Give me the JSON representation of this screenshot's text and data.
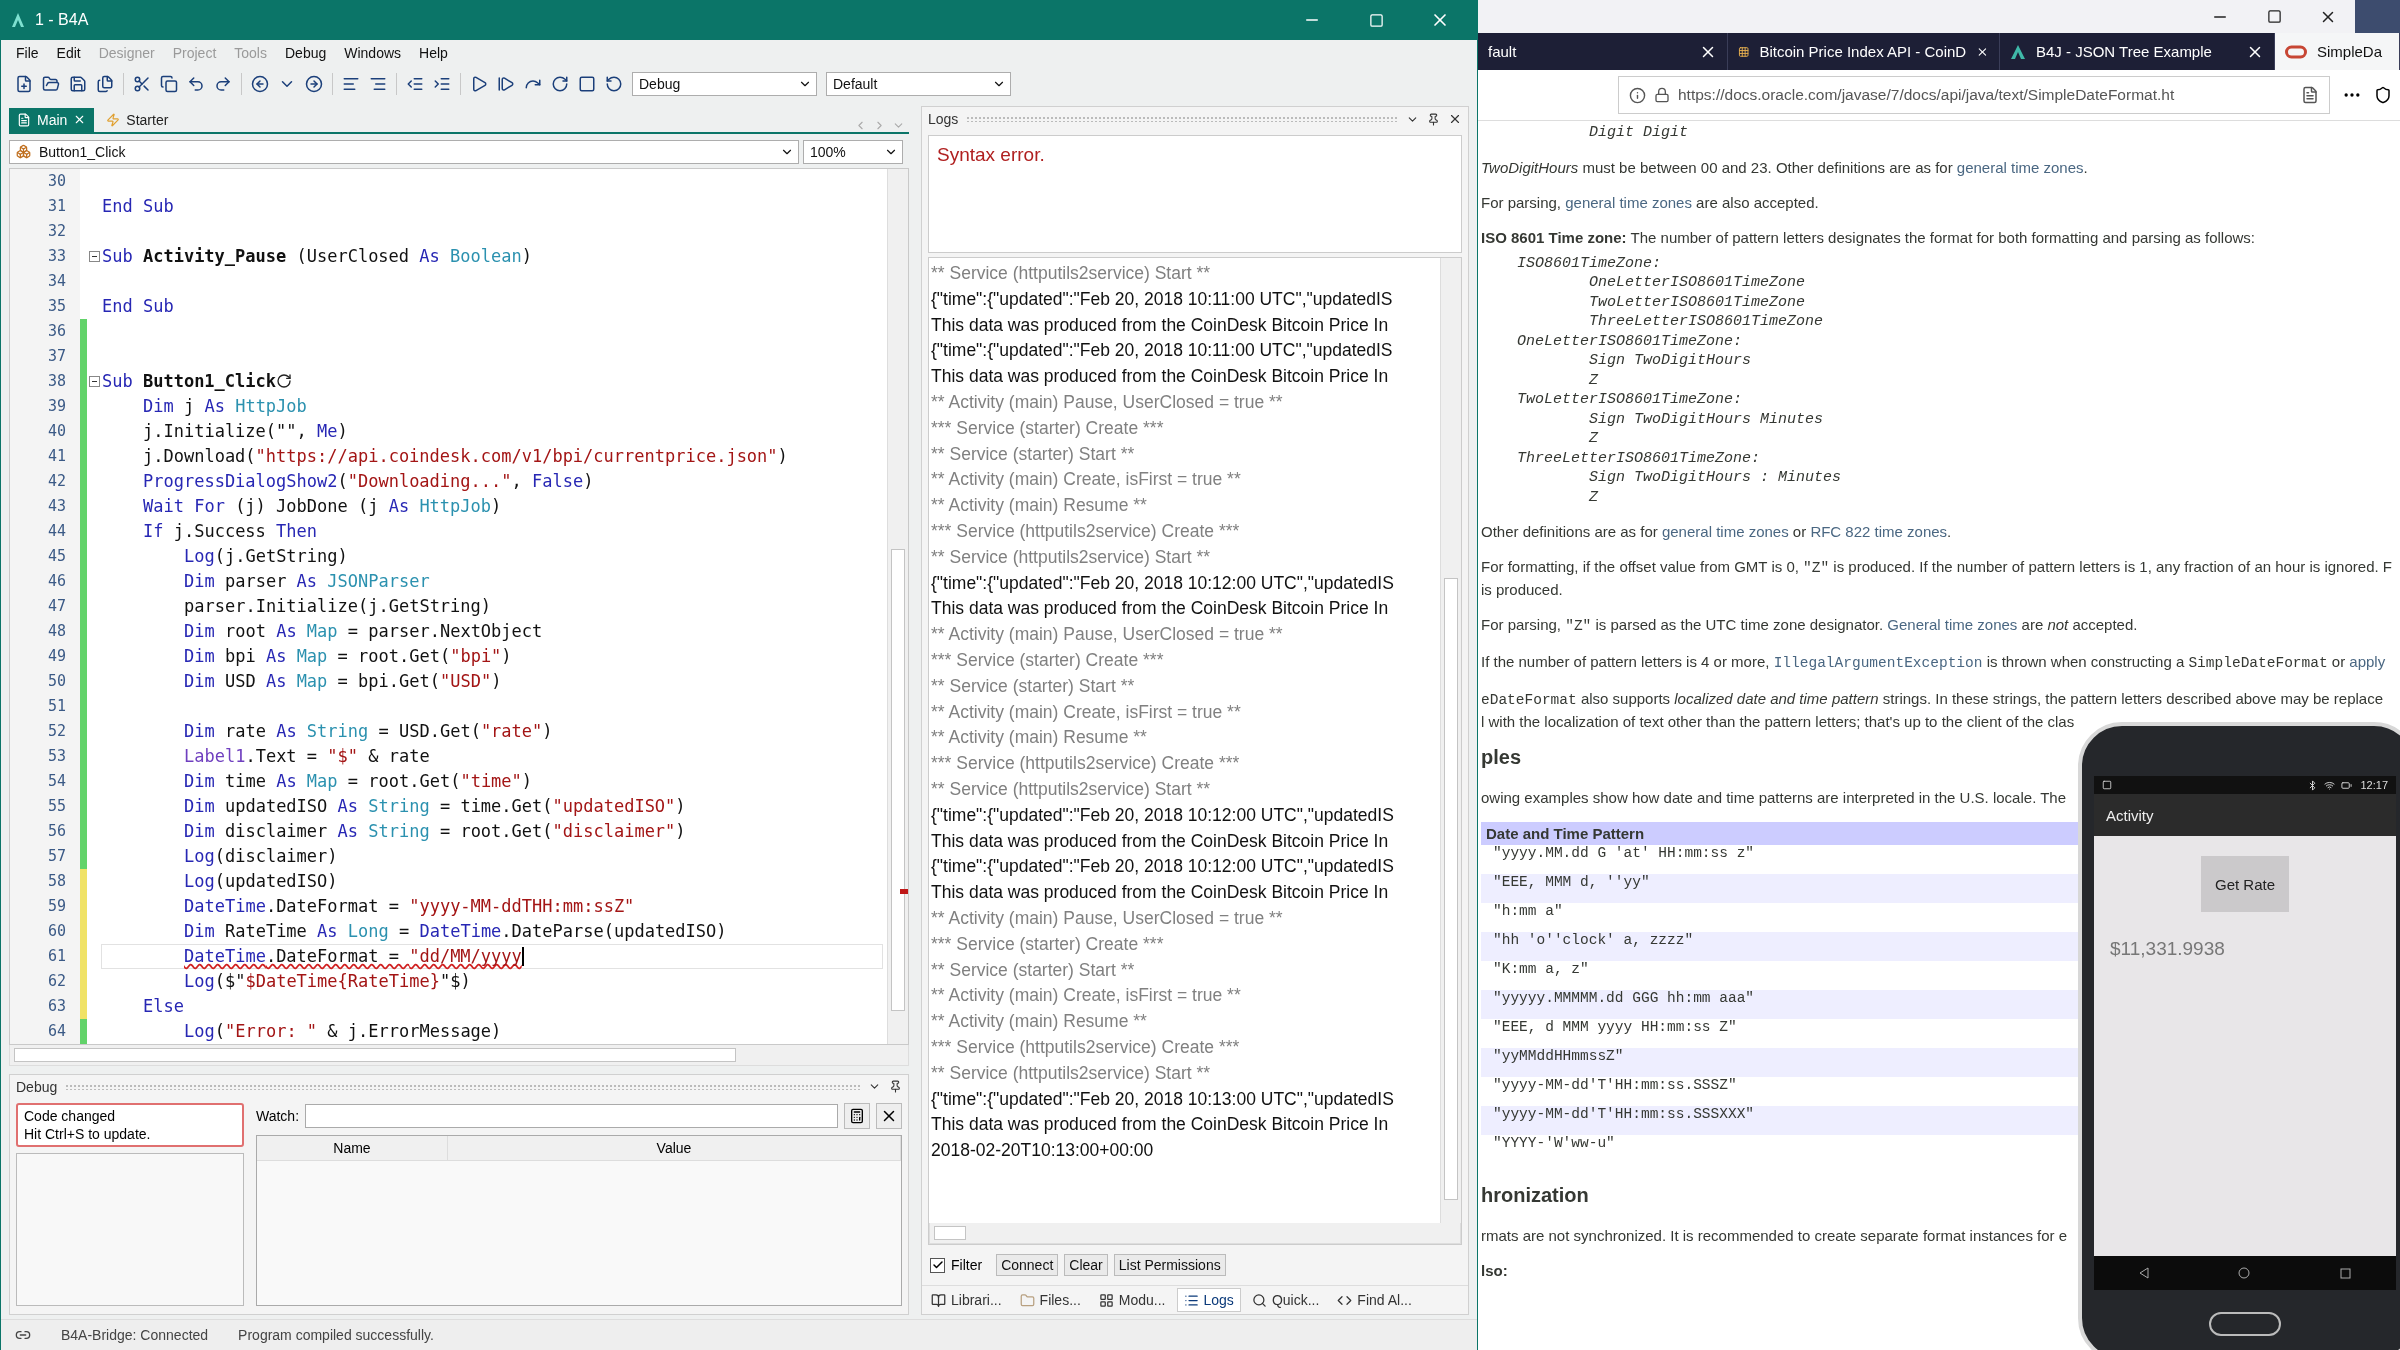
{
  "ide": {
    "title": "1 - B4A",
    "menu": [
      {
        "label": "File",
        "disabled": false
      },
      {
        "label": "Edit",
        "disabled": false
      },
      {
        "label": "Designer",
        "disabled": true
      },
      {
        "label": "Project",
        "disabled": true
      },
      {
        "label": "Tools",
        "disabled": true
      },
      {
        "label": "Debug",
        "disabled": false
      },
      {
        "label": "Windows",
        "disabled": false
      },
      {
        "label": "Help",
        "disabled": false
      }
    ],
    "toolbar": {
      "build_config": "Debug",
      "variant": "Default"
    },
    "editor": {
      "tabs": [
        {
          "label": "Main",
          "selected": true
        },
        {
          "label": "Starter",
          "selected": false
        }
      ],
      "member": "Button1_Click",
      "zoom": "100%",
      "lines": [
        {
          "no": "30"
        },
        {
          "no": "31",
          "tokens": [
            {
              "kind": "kw",
              "text": "End Sub"
            }
          ]
        },
        {
          "no": "32"
        },
        {
          "no": "33",
          "tokens": [
            {
              "kind": "fold"
            },
            {
              "kind": "kw",
              "text": "Sub "
            },
            {
              "kind": "name",
              "text": "Activity_Pause"
            },
            {
              "kind": "plain",
              "text": " (UserClosed "
            },
            {
              "kind": "kw",
              "text": "As "
            },
            {
              "kind": "type",
              "text": "Boolean"
            },
            {
              "kind": "plain",
              "text": ")"
            }
          ]
        },
        {
          "no": "34"
        },
        {
          "no": "35",
          "tokens": [
            {
              "kind": "kw",
              "text": "End Sub"
            }
          ]
        },
        {
          "no": "36",
          "color": "#62d36a"
        },
        {
          "no": "37",
          "color": "#62d36a"
        },
        {
          "no": "38",
          "color": "#62d36a",
          "tokens": [
            {
              "kind": "fold"
            },
            {
              "kind": "kw",
              "text": "Sub "
            },
            {
              "kind": "name",
              "text": "Button1_Click"
            },
            {
              "kind": "restart_mark"
            }
          ],
          "children": [
            {
              "no": "39",
              "color": "#62d36a",
              "tokens": [
                {
                  "kind": "kw",
                  "text": "Dim "
                },
                {
                  "kind": "plain",
                  "text": "j "
                },
                {
                  "kind": "kw",
                  "text": "As "
                },
                {
                  "kind": "type",
                  "text": "HttpJob"
                }
              ]
            },
            {
              "no": "40",
              "color": "#62d36a",
              "tokens": [
                {
                  "kind": "plain",
                  "text": "j.Initialize(\"\", "
                },
                {
                  "kind": "kw",
                  "text": "Me"
                },
                {
                  "kind": "plain",
                  "text": ")"
                }
              ]
            },
            {
              "no": "41",
              "color": "#62d36a",
              "tokens": [
                {
                  "kind": "plain",
                  "text": "j.Download("
                },
                {
                  "kind": "str",
                  "text": "\"https://api.coindesk.com/v1/bpi/currentprice.json\""
                },
                {
                  "kind": "plain",
                  "text": ")"
                }
              ]
            },
            {
              "no": "42",
              "color": "#62d36a",
              "tokens": [
                {
                  "kind": "kw",
                  "text": "ProgressDialogShow2"
                },
                {
                  "kind": "plain",
                  "text": "("
                },
                {
                  "kind": "str",
                  "text": "\"Downloading...\""
                },
                {
                  "kind": "plain",
                  "text": ", "
                },
                {
                  "kind": "kw",
                  "text": "False"
                },
                {
                  "kind": "plain",
                  "text": ")"
                }
              ]
            },
            {
              "no": "43",
              "color": "#62d36a",
              "tokens": [
                {
                  "kind": "kw",
                  "text": "Wait For "
                },
                {
                  "kind": "plain",
                  "text": "(j) JobDone (j "
                },
                {
                  "kind": "kw",
                  "text": "As "
                },
                {
                  "kind": "type",
                  "text": "HttpJob"
                },
                {
                  "kind": "plain",
                  "text": ")"
                }
              ]
            },
            {
              "no": "44",
              "color": "#62d36a",
              "tokens": [
                {
                  "kind": "kw",
                  "text": "If "
                },
                {
                  "kind": "plain",
                  "text": "j.Success "
                },
                {
                  "kind": "kw",
                  "text": "Then"
                }
              ],
              "children": [
                {
                  "no": "45",
                  "color": "#62d36a",
                  "tokens": [
                    {
                      "kind": "kw",
                      "text": "Log"
                    },
                    {
                      "kind": "plain",
                      "text": "(j.GetString)"
                    }
                  ]
                },
                {
                  "no": "46",
                  "color": "#62d36a",
                  "tokens": [
                    {
                      "kind": "kw",
                      "text": "Dim "
                    },
                    {
                      "kind": "plain",
                      "text": "parser "
                    },
                    {
                      "kind": "kw",
                      "text": "As "
                    },
                    {
                      "kind": "type",
                      "text": "JSONParser"
                    }
                  ]
                },
                {
                  "no": "47",
                  "color": "#62d36a",
                  "tokens": [
                    {
                      "kind": "plain",
                      "text": "parser.Initialize(j.GetString)"
                    }
                  ]
                },
                {
                  "no": "48",
                  "color": "#62d36a",
                  "tokens": [
                    {
                      "kind": "kw",
                      "text": "Dim "
                    },
                    {
                      "kind": "plain",
                      "text": "root "
                    },
                    {
                      "kind": "kw",
                      "text": "As "
                    },
                    {
                      "kind": "type",
                      "text": "Map"
                    },
                    {
                      "kind": "plain",
                      "text": " = parser.NextObject"
                    }
                  ]
                },
                {
                  "no": "49",
                  "color": "#62d36a",
                  "tokens": [
                    {
                      "kind": "kw",
                      "text": "Dim "
                    },
                    {
                      "kind": "plain",
                      "text": "bpi "
                    },
                    {
                      "kind": "kw",
                      "text": "As "
                    },
                    {
                      "kind": "type",
                      "text": "Map"
                    },
                    {
                      "kind": "plain",
                      "text": " = root.Get("
                    },
                    {
                      "kind": "str",
                      "text": "\"bpi\""
                    },
                    {
                      "kind": "plain",
                      "text": ")"
                    }
                  ]
                },
                {
                  "no": "50",
                  "color": "#62d36a",
                  "tokens": [
                    {
                      "kind": "kw",
                      "text": "Dim "
                    },
                    {
                      "kind": "plain",
                      "text": "USD "
                    },
                    {
                      "kind": "kw",
                      "text": "As "
                    },
                    {
                      "kind": "type",
                      "text": "Map"
                    },
                    {
                      "kind": "plain",
                      "text": " = bpi.Get("
                    },
                    {
                      "kind": "str",
                      "text": "\"USD\""
                    },
                    {
                      "kind": "plain",
                      "text": ")"
                    }
                  ]
                },
                {
                  "no": "51",
                  "color": "#62d36a"
                },
                {
                  "no": "52",
                  "color": "#62d36a",
                  "tokens": [
                    {
                      "kind": "kw",
                      "text": "Dim "
                    },
                    {
                      "kind": "plain",
                      "text": "rate "
                    },
                    {
                      "kind": "kw",
                      "text": "As "
                    },
                    {
                      "kind": "type",
                      "text": "String"
                    },
                    {
                      "kind": "plain",
                      "text": " = USD.Get("
                    },
                    {
                      "kind": "str",
                      "text": "\"rate\""
                    },
                    {
                      "kind": "plain",
                      "text": ")"
                    }
                  ]
                },
                {
                  "no": "53",
                  "color": "#62d36a",
                  "tokens": [
                    {
                      "kind": "obj",
                      "text": "Label1"
                    },
                    {
                      "kind": "plain",
                      "text": ".Text = "
                    },
                    {
                      "kind": "str",
                      "text": "\"$\""
                    },
                    {
                      "kind": "plain",
                      "text": " & rate"
                    }
                  ]
                },
                {
                  "no": "54",
                  "color": "#62d36a",
                  "tokens": [
                    {
                      "kind": "kw",
                      "text": "Dim "
                    },
                    {
                      "kind": "plain",
                      "text": "time "
                    },
                    {
                      "kind": "kw",
                      "text": "As "
                    },
                    {
                      "kind": "type",
                      "text": "Map"
                    },
                    {
                      "kind": "plain",
                      "text": " = root.Get("
                    },
                    {
                      "kind": "str",
                      "text": "\"time\""
                    },
                    {
                      "kind": "plain",
                      "text": ")"
                    }
                  ]
                },
                {
                  "no": "55",
                  "color": "#62d36a",
                  "tokens": [
                    {
                      "kind": "kw",
                      "text": "Dim "
                    },
                    {
                      "kind": "plain",
                      "text": "updatedISO "
                    },
                    {
                      "kind": "kw",
                      "text": "As "
                    },
                    {
                      "kind": "type",
                      "text": "String"
                    },
                    {
                      "kind": "plain",
                      "text": " = time.Get("
                    },
                    {
                      "kind": "str",
                      "text": "\"updatedISO\""
                    },
                    {
                      "kind": "plain",
                      "text": ")"
                    }
                  ]
                },
                {
                  "no": "56",
                  "color": "#62d36a",
                  "tokens": [
                    {
                      "kind": "kw",
                      "text": "Dim "
                    },
                    {
                      "kind": "plain",
                      "text": "disclaimer "
                    },
                    {
                      "kind": "kw",
                      "text": "As "
                    },
                    {
                      "kind": "type",
                      "text": "String"
                    },
                    {
                      "kind": "plain",
                      "text": " = root.Get("
                    },
                    {
                      "kind": "str",
                      "text": "\"disclaimer\""
                    },
                    {
                      "kind": "plain",
                      "text": ")"
                    }
                  ]
                },
                {
                  "no": "57",
                  "color": "#62d36a",
                  "tokens": [
                    {
                      "kind": "kw",
                      "text": "Log"
                    },
                    {
                      "kind": "plain",
                      "text": "(disclaimer)"
                    }
                  ]
                },
                {
                  "no": "58",
                  "color": "#f0e266",
                  "tokens": [
                    {
                      "kind": "kw",
                      "text": "Log"
                    },
                    {
                      "kind": "plain",
                      "text": "(updatedISO)"
                    }
                  ]
                },
                {
                  "no": "59",
                  "color": "#f0e266",
                  "tokens": [
                    {
                      "kind": "kw",
                      "text": "DateTime"
                    },
                    {
                      "kind": "plain",
                      "text": ".DateFormat = "
                    },
                    {
                      "kind": "str",
                      "text": "\"yyyy-MM-ddTHH:mm:ssZ\""
                    }
                  ]
                },
                {
                  "no": "60",
                  "color": "#f0e266",
                  "tokens": [
                    {
                      "kind": "kw",
                      "text": "Dim "
                    },
                    {
                      "kind": "plain",
                      "text": "RateTime "
                    },
                    {
                      "kind": "kw",
                      "text": "As "
                    },
                    {
                      "kind": "type",
                      "text": "Long"
                    },
                    {
                      "kind": "plain",
                      "text": " = "
                    },
                    {
                      "kind": "kw",
                      "text": "DateTime"
                    },
                    {
                      "kind": "plain",
                      "text": ".DateParse(updatedISO)"
                    }
                  ]
                },
                {
                  "no": "61",
                  "color": "#f0e266",
                  "tokens": [
                    {
                      "kind": "err_kw",
                      "text": "DateTime"
                    },
                    {
                      "kind": "err_plain",
                      "text": ".DateFormat = "
                    },
                    {
                      "kind": "err_str",
                      "text": "\"dd/MM/yyyy"
                    },
                    {
                      "kind": "caret"
                    }
                  ]
                },
                {
                  "no": "62",
                  "color": "#f0e266",
                  "tokens": [
                    {
                      "kind": "kw",
                      "text": "Log"
                    },
                    {
                      "kind": "plain",
                      "text": "($\""
                    },
                    {
                      "kind": "str",
                      "text": "$DateTime{RateTime}"
                    },
                    {
                      "kind": "plain",
                      "text": "\"$)"
                    }
                  ]
                }
              ]
            },
            {
              "no": "63",
              "color": "#f0e266",
              "tokens": [
                {
                  "kind": "kw",
                  "text": "Else"
                }
              ],
              "children": [
                {
                  "no": "64",
                  "color": "#62d36a",
                  "tokens": [
                    {
                      "kind": "kw",
                      "text": "Log"
                    },
                    {
                      "kind": "plain",
                      "text": "("
                    },
                    {
                      "kind": "str",
                      "text": "\"Error: \""
                    },
                    {
                      "kind": "plain",
                      "text": " & j.ErrorMessage)"
                    }
                  ]
                }
              ]
            }
          ]
        }
      ]
    },
    "logs": {
      "title": "Logs",
      "message": "Syntax error.",
      "lines": [
        {
          "kind": "sys",
          "text": "** Service (httputils2service) Start **"
        },
        {
          "kind": "out",
          "text": "{\"time\":{\"updated\":\"Feb 20, 2018 10:11:00 UTC\",\"updatedIS"
        },
        {
          "kind": "out",
          "text": "This data was produced from the CoinDesk Bitcoin Price In"
        },
        {
          "kind": "out",
          "text": "{\"time\":{\"updated\":\"Feb 20, 2018 10:11:00 UTC\",\"updatedIS"
        },
        {
          "kind": "out",
          "text": "This data was produced from the CoinDesk Bitcoin Price In"
        },
        {
          "kind": "sys",
          "text": "** Activity (main) Pause, UserClosed = true **"
        },
        {
          "kind": "sys",
          "text": "*** Service (starter) Create ***"
        },
        {
          "kind": "sys",
          "text": "** Service (starter) Start **"
        },
        {
          "kind": "sys",
          "text": "** Activity (main) Create, isFirst = true **"
        },
        {
          "kind": "sys",
          "text": "** Activity (main) Resume **"
        },
        {
          "kind": "sys",
          "text": "*** Service (httputils2service) Create ***"
        },
        {
          "kind": "sys",
          "text": "** Service (httputils2service) Start **"
        },
        {
          "kind": "out",
          "text": "{\"time\":{\"updated\":\"Feb 20, 2018 10:12:00 UTC\",\"updatedIS"
        },
        {
          "kind": "out",
          "text": "This data was produced from the CoinDesk Bitcoin Price In"
        },
        {
          "kind": "sys",
          "text": "** Activity (main) Pause, UserClosed = true **"
        },
        {
          "kind": "sys",
          "text": "*** Service (starter) Create ***"
        },
        {
          "kind": "sys",
          "text": "** Service (starter) Start **"
        },
        {
          "kind": "sys",
          "text": "** Activity (main) Create, isFirst = true **"
        },
        {
          "kind": "sys",
          "text": "** Activity (main) Resume **"
        },
        {
          "kind": "sys",
          "text": "*** Service (httputils2service) Create ***"
        },
        {
          "kind": "sys",
          "text": "** Service (httputils2service) Start **"
        },
        {
          "kind": "out",
          "text": "{\"time\":{\"updated\":\"Feb 20, 2018 10:12:00 UTC\",\"updatedIS"
        },
        {
          "kind": "out",
          "text": "This data was produced from the CoinDesk Bitcoin Price In"
        },
        {
          "kind": "out",
          "text": "{\"time\":{\"updated\":\"Feb 20, 2018 10:12:00 UTC\",\"updatedIS"
        },
        {
          "kind": "out",
          "text": "This data was produced from the CoinDesk Bitcoin Price In"
        },
        {
          "kind": "sys",
          "text": "** Activity (main) Pause, UserClosed = true **"
        },
        {
          "kind": "sys",
          "text": "*** Service (starter) Create ***"
        },
        {
          "kind": "sys",
          "text": "** Service (starter) Start **"
        },
        {
          "kind": "sys",
          "text": "** Activity (main) Create, isFirst = true **"
        },
        {
          "kind": "sys",
          "text": "** Activity (main) Resume **"
        },
        {
          "kind": "sys",
          "text": "*** Service (httputils2service) Create ***"
        },
        {
          "kind": "sys",
          "text": "** Service (httputils2service) Start **"
        },
        {
          "kind": "out",
          "text": "{\"time\":{\"updated\":\"Feb 20, 2018 10:13:00 UTC\",\"updatedIS"
        },
        {
          "kind": "out",
          "text": "This data was produced from the CoinDesk Bitcoin Price In"
        },
        {
          "kind": "out",
          "text": "2018-02-20T10:13:00+00:00"
        }
      ],
      "filter": {
        "label": "Filter",
        "checked": true
      },
      "buttons": [
        "Connect",
        "Clear",
        "List Permissions"
      ],
      "panel_tabs": [
        {
          "label": "Librari...",
          "kind": "libraries",
          "selected": false
        },
        {
          "label": "Files...",
          "kind": "files",
          "selected": false
        },
        {
          "label": "Modu...",
          "kind": "modules",
          "selected": false
        },
        {
          "label": "Logs",
          "kind": "logs",
          "selected": true
        },
        {
          "label": "Quick...",
          "kind": "search",
          "selected": false
        },
        {
          "label": "Find Al...",
          "kind": "find",
          "selected": false
        }
      ]
    },
    "debug": {
      "title": "Debug",
      "notice": [
        "Code changed",
        "Hit Ctrl+S to update."
      ],
      "watch_label": "Watch:",
      "columns": [
        "Name",
        "Value"
      ]
    },
    "status_bar": {
      "bridge": "B4A-Bridge: Connected",
      "message": "Program compiled successfully."
    }
  },
  "browser": {
    "tabs": [
      {
        "label": "fault",
        "kind": "plain",
        "selected": false
      },
      {
        "label": "Bitcoin Price Index API - CoinD",
        "kind": "grid",
        "selected": false
      },
      {
        "label": "B4J - JSON Tree Example",
        "kind": "b4x",
        "selected": false
      },
      {
        "label": "SimpleDa",
        "kind": "oracle",
        "selected": true
      }
    ],
    "url": "https://docs.oracle.com/javase/7/docs/api/java/text/SimpleDateFormat.ht",
    "content": [
      {
        "kind": "pre",
        "lines": [
          "            Digit Digit"
        ]
      },
      {
        "kind": "p",
        "segments": [
          {
            "kind": "italic",
            "text": "TwoDigitHours"
          },
          {
            "kind": "text",
            "text": " must be between 00 and 23. Other definitions are as for "
          },
          {
            "kind": "link",
            "text": "general time zones"
          },
          {
            "kind": "text",
            "text": "."
          }
        ]
      },
      {
        "kind": "p",
        "segments": [
          {
            "kind": "text",
            "text": "For parsing, "
          },
          {
            "kind": "link",
            "text": "general time zones"
          },
          {
            "kind": "text",
            "text": " are also accepted."
          }
        ]
      },
      {
        "kind": "p",
        "segments": [
          {
            "kind": "bold",
            "text": "ISO 8601 Time zone:"
          },
          {
            "kind": "text",
            "text": " The number of pattern letters designates the format for both formatting and parsing as follows:"
          }
        ]
      },
      {
        "kind": "pre",
        "lines": [
          "    ISO8601TimeZone:",
          "            OneLetterISO8601TimeZone",
          "            TwoLetterISO8601TimeZone",
          "            ThreeLetterISO8601TimeZone",
          "    OneLetterISO8601TimeZone:",
          "            Sign TwoDigitHours",
          "            Z",
          "    TwoLetterISO8601TimeZone:",
          "            Sign TwoDigitHours Minutes",
          "            Z",
          "    ThreeLetterISO8601TimeZone:",
          "            Sign TwoDigitHours : Minutes",
          "            Z"
        ]
      },
      {
        "kind": "p",
        "segments": [
          {
            "kind": "text",
            "text": "Other definitions are as for "
          },
          {
            "kind": "link",
            "text": "general time zones"
          },
          {
            "kind": "text",
            "text": " or "
          },
          {
            "kind": "link",
            "text": "RFC 822 time zones"
          },
          {
            "kind": "text",
            "text": "."
          }
        ]
      },
      {
        "kind": "p",
        "segments": [
          {
            "kind": "text",
            "text": "For formatting, if the offset value from GMT is 0, "
          },
          {
            "kind": "code",
            "text": "\"Z\""
          },
          {
            "kind": "text",
            "text": " is produced. If the number of pattern letters is 1, any fraction of an hour is ignored. F"
          },
          {
            "kind": "break"
          },
          {
            "kind": "text",
            "text": "is produced."
          }
        ]
      },
      {
        "kind": "p",
        "segments": [
          {
            "kind": "text",
            "text": "For parsing, "
          },
          {
            "kind": "code",
            "text": "\"Z\""
          },
          {
            "kind": "text",
            "text": " is parsed as the UTC time zone designator. "
          },
          {
            "kind": "link",
            "text": "General time zones"
          },
          {
            "kind": "text",
            "text": " are "
          },
          {
            "kind": "italic",
            "text": "not"
          },
          {
            "kind": "text",
            "text": " accepted."
          }
        ]
      },
      {
        "kind": "p",
        "segments": [
          {
            "kind": "text",
            "text": "If the number of pattern letters is 4 or more, "
          },
          {
            "kind": "codelink",
            "text": "IllegalArgumentException"
          },
          {
            "kind": "text",
            "text": " is thrown when constructing a "
          },
          {
            "kind": "code",
            "text": "SimpleDateFormat"
          },
          {
            "kind": "text",
            "text": " or "
          },
          {
            "kind": "link",
            "text": "apply"
          }
        ]
      },
      {
        "kind": "p",
        "segments": [
          {
            "kind": "code",
            "text": "eDateFormat"
          },
          {
            "kind": "text",
            "text": " also supports "
          },
          {
            "kind": "italic",
            "text": "localized date and time pattern"
          },
          {
            "kind": "text",
            "text": " strings. In these strings, the pattern letters described above may be replace"
          },
          {
            "kind": "break"
          },
          {
            "kind": "text",
            "text": "l with the localization of text other than the pattern letters; that's up to the client of the clas"
          }
        ]
      },
      {
        "kind": "h",
        "text": "ples"
      },
      {
        "kind": "p",
        "segments": [
          {
            "kind": "text",
            "text": "owing examples show how date and time patterns are interpreted in the U.S. locale. The"
          }
        ]
      },
      {
        "kind": "table",
        "header": "Date and Time Pattern",
        "rows": [
          "\"yyyy.MM.dd G 'at' HH:mm:ss z\"",
          "\"EEE, MMM d, ''yy\"",
          "\"h:mm a\"",
          "\"hh 'o''clock' a, zzzz\"",
          "\"K:mm a, z\"",
          "\"yyyyy.MMMMM.dd GGG hh:mm aaa\"",
          "\"EEE, d MMM yyyy HH:mm:ss Z\"",
          "\"yyMMddHHmmssZ\"",
          "\"yyyy-MM-dd'T'HH:mm:ss.SSSZ\"",
          "\"yyyy-MM-dd'T'HH:mm:ss.SSSXXX\"",
          "\"YYYY-'W'ww-u\""
        ]
      },
      {
        "kind": "h",
        "text": "hronization"
      },
      {
        "kind": "p",
        "segments": [
          {
            "kind": "text",
            "text": "rmats are not synchronized. It is recommended to create separate format instances for e"
          }
        ]
      },
      {
        "kind": "p",
        "segments": [
          {
            "kind": "bold",
            "text": "lso:"
          }
        ]
      }
    ],
    "phone": {
      "time": "12:17",
      "title": "Activity",
      "button": "Get Rate",
      "label": "$11,331.9938"
    }
  }
}
